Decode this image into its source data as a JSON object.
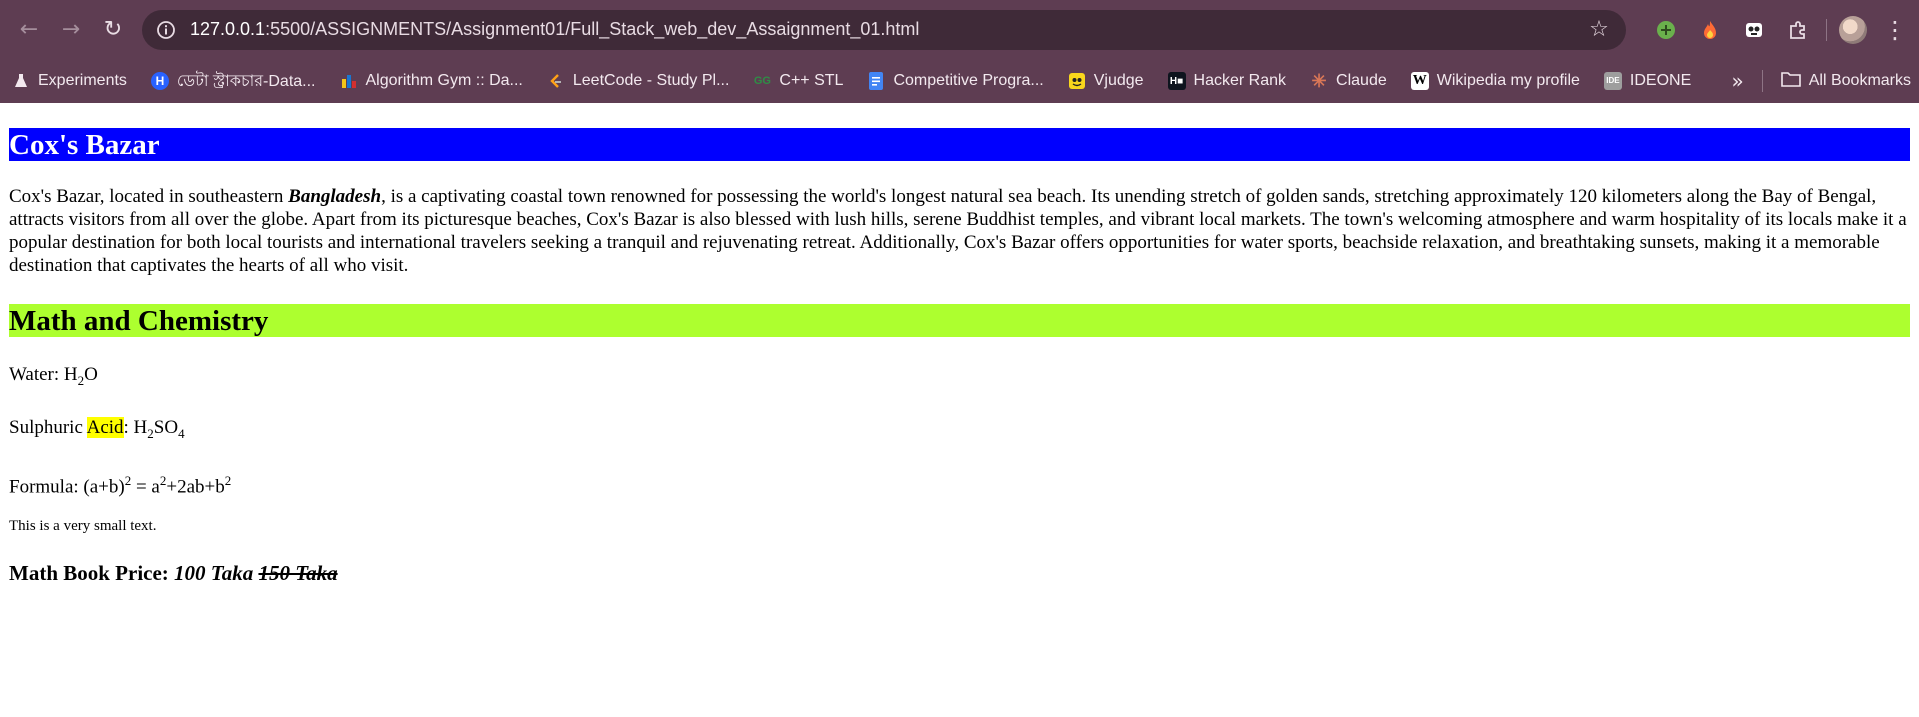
{
  "browser": {
    "url_host": "127.0.0.1",
    "url_rest": ":5500/ASSIGNMENTS/Assignment01/Full_Stack_web_dev_Assaignment_01.html",
    "bookmarks": [
      {
        "label": "Experiments",
        "icon": "flask-icon"
      },
      {
        "label": "ডেটা স্ট্রাকচার-Data...",
        "icon": "hashnode-icon"
      },
      {
        "label": "Algorithm Gym :: Da...",
        "icon": "codeforces-icon"
      },
      {
        "label": "LeetCode - Study Pl...",
        "icon": "leetcode-icon"
      },
      {
        "label": "C++ STL",
        "icon": "gfg-icon"
      },
      {
        "label": "Competitive Progra...",
        "icon": "docs-icon"
      },
      {
        "label": "Vjudge",
        "icon": "vjudge-icon"
      },
      {
        "label": "Hacker Rank",
        "icon": "hackerrank-icon"
      },
      {
        "label": "Claude",
        "icon": "claude-icon"
      },
      {
        "label": "Wikipedia my profile",
        "icon": "wikipedia-icon"
      },
      {
        "label": "IDEONE",
        "icon": "ideone-icon"
      }
    ],
    "all_bookmarks": "All Bookmarks"
  },
  "page": {
    "h1": "Cox's Bazar",
    "intro_before": "Cox's Bazar, located in southeastern ",
    "intro_strong": "Bangladesh",
    "intro_after": ", is a captivating coastal town renowned for possessing the world's longest natural sea beach. Its unending stretch of golden sands, stretching approximately 120 kilometers along the Bay of Bengal, attracts visitors from all over the globe. Apart from its picturesque beaches, Cox's Bazar is also blessed with lush hills, serene Buddhist temples, and vibrant local markets. The town's welcoming atmosphere and warm hospitality of its locals make it a popular destination for both local tourists and international travelers seeking a tranquil and rejuvenating retreat. Additionally, Cox's Bazar offers opportunities for water sports, beachside relaxation, and breathtaking sunsets, making it a memorable destination that captivates the hearts of all who visit.",
    "h2": "Math and Chemistry",
    "water_label": "Water: H",
    "water_sub": "2",
    "water_end": "O",
    "sulph_label": "Sulphuric ",
    "sulph_mark": "Acid",
    "sulph_colon": ": H",
    "sulph_sub1": "2",
    "sulph_mid": "SO",
    "sulph_sub2": "4",
    "formula_label": "Formula: (a+b)",
    "formula_sup1": "2",
    "formula_mid": " = a",
    "formula_sup2": "2",
    "formula_mid2": "+2ab+b",
    "formula_sup3": "2",
    "small_text": "This is a very small text.",
    "price_label": "Math Book Price: ",
    "price_now": "100 Taka",
    "price_old": "150 Taka"
  }
}
